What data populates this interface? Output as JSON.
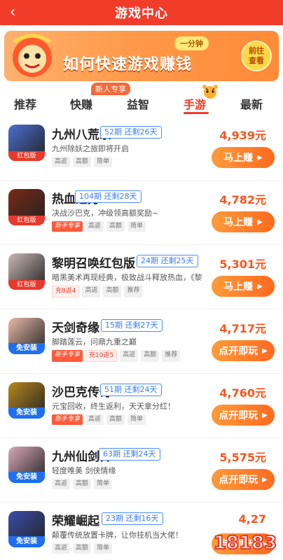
{
  "header": {
    "title": "游戏中心",
    "back_icon": "chevron-left-icon"
  },
  "banner": {
    "mascot_icon": "lion-dance-mascot",
    "pill": "一分钟",
    "headline": "如何快速游戏赚钱",
    "go_line1": "前往",
    "go_line2": "查看"
  },
  "tabs": {
    "badge": "新人专享",
    "items": [
      "推荐",
      "快赚",
      "益智",
      "手游",
      "最新"
    ],
    "active": "手游"
  },
  "games": [
    {
      "name": "九州八荒录",
      "period": "52期",
      "remain": "还剩26天",
      "desc": "九州除妖之旅即将开启",
      "tags": [
        "高返",
        "高额",
        "简单"
      ],
      "new_tag": "",
      "charge_tag": "",
      "icon_tag": "红包版",
      "icon_tag_type": "red",
      "price": "4,939元",
      "button": "马上赚",
      "icon_color": "#4a6fd0"
    },
    {
      "name": "热血之刃",
      "period": "104期",
      "remain": "还剩28天",
      "desc": "决战沙巴克，冲级领高额奖励~",
      "tags": [
        "高返",
        "高额",
        "简单"
      ],
      "new_tag": "新手专享",
      "charge_tag": "",
      "icon_tag": "红包版",
      "icon_tag_type": "red",
      "price": "4,782元",
      "button": "马上赚",
      "icon_color": "#7a2a16"
    },
    {
      "name": "黎明召唤红包版",
      "period": "24期",
      "remain": "还剩25天",
      "desc": "暗黑美术再现经典，极致战斗释放热血，《黎",
      "tags": [
        "高返",
        "高额",
        "推荐"
      ],
      "new_tag": "",
      "charge_tag": "充8返4",
      "icon_tag": "红包版",
      "icon_tag_type": "red",
      "price": "5,301元",
      "button": "马上赚",
      "icon_color": "#c9b8b4"
    },
    {
      "name": "天剑奇缘",
      "period": "15期",
      "remain": "还剩27天",
      "desc": "脚踏莲云，问鼎九重之巅",
      "tags": [
        "高返",
        "高额",
        "推荐"
      ],
      "new_tag": "新手专享",
      "charge_tag": "充10返5",
      "icon_tag": "免安装",
      "icon_tag_type": "blue",
      "price": "4,717元",
      "button": "点开即玩",
      "icon_color": "#e8b9a8"
    },
    {
      "name": "沙巴克传奇",
      "period": "51期",
      "remain": "还剩24天",
      "desc": "元宝回收，终生返利，天天拿分红！",
      "tags": [
        "高返",
        "高额",
        "简单"
      ],
      "new_tag": "新手专享",
      "charge_tag": "",
      "icon_tag": "免安装",
      "icon_tag_type": "blue",
      "price": "4,760元",
      "button": "点开即玩",
      "icon_color": "#b8861e"
    },
    {
      "name": "九州仙剑传",
      "period": "63期",
      "remain": "还剩24天",
      "desc": "轻度唯美 剑侠情缘",
      "tags": [
        "高返",
        "高额",
        "简单"
      ],
      "new_tag": "",
      "charge_tag": "",
      "icon_tag": "免安装",
      "icon_tag_type": "blue",
      "price": "5,575元",
      "button": "点开即玩",
      "icon_color": "#d9a7b8"
    },
    {
      "name": "荣耀崛起",
      "period": "23期",
      "remain": "还剩16天",
      "desc": "颠覆传统放置卡牌，让你挂机当大佬！",
      "tags": [
        "高返",
        "高额",
        "简单"
      ],
      "new_tag": "",
      "charge_tag": "",
      "icon_tag": "免安装",
      "icon_tag_type": "blue",
      "price": "4,27",
      "button": "点开即玩",
      "icon_color": "#3a4ea8"
    }
  ],
  "watermark": "18183",
  "colors": {
    "primary": "#f23c2a",
    "accent": "#f7561f",
    "period_blue": "#3d7fe8"
  }
}
